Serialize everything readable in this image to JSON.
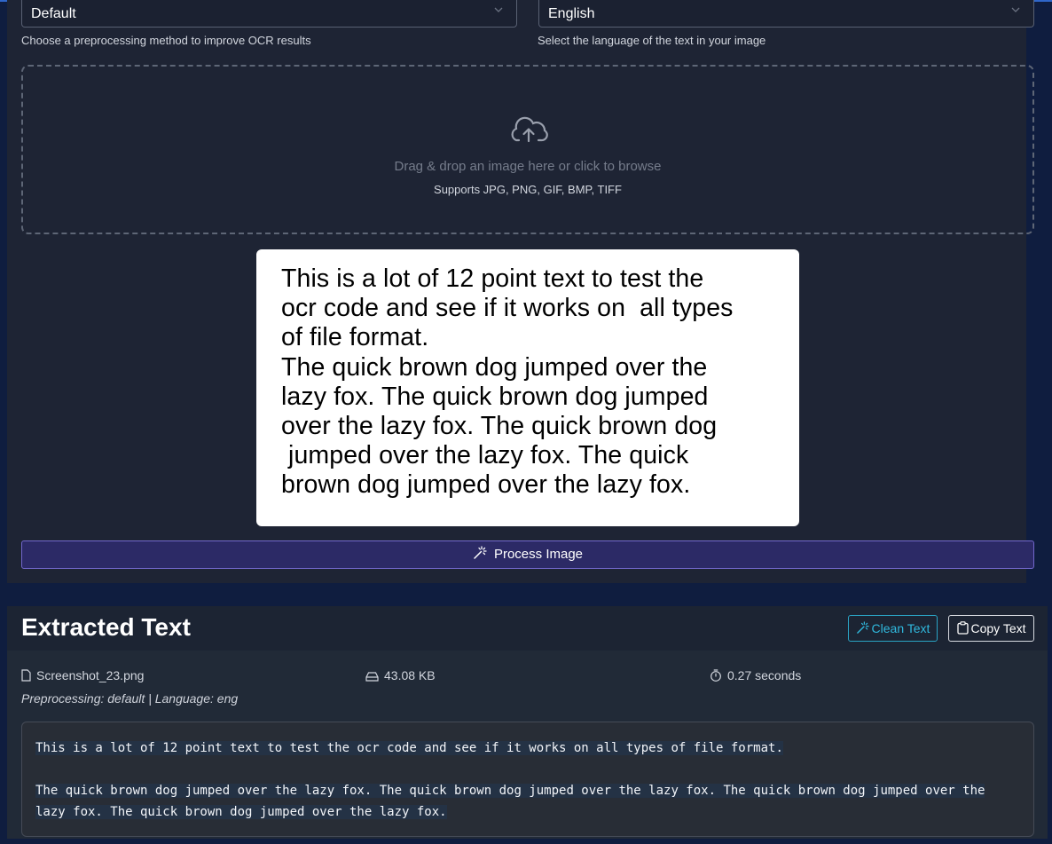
{
  "colors": {
    "background": "#0f1d3f",
    "panel": "#1e2434",
    "accent_purple": "#2c2a66",
    "accent_cyan": "#30b9de"
  },
  "preprocessing": {
    "selected": "Default",
    "hint": "Choose a preprocessing method to improve OCR results"
  },
  "language": {
    "selected": "English",
    "hint": "Select the language of the text in your image"
  },
  "dropzone": {
    "icon": "cloud-upload-icon",
    "main_text": "Drag & drop an image here or click to browse",
    "sub_text": "Supports JPG, PNG, GIF, BMP, TIFF"
  },
  "preview_image": {
    "lines": [
      "This is a lot of 12 point text to test the",
      "ocr code and see if it works on  all types",
      "of file format.",
      "The quick brown dog jumped over the",
      "lazy fox. The quick brown dog jumped",
      "over the lazy fox. The quick brown dog",
      " jumped over the lazy fox. The quick",
      "brown dog jumped over the lazy fox."
    ]
  },
  "process_button": {
    "label": "Process Image",
    "icon": "magic-wand-icon"
  },
  "result": {
    "title": "Extracted Text",
    "clean_label": "Clean Text",
    "copy_label": "Copy Text",
    "file_name": "Screenshot_23.png",
    "file_size": "43.08 KB",
    "duration": "0.27 seconds",
    "details": "Preprocessing: default | Language: eng",
    "paragraph_1": "This is a lot of 12 point text to test the ocr code and see if it works on all types of file format.",
    "paragraph_2": "The quick brown dog jumped over the lazy fox. The quick brown dog jumped over the lazy fox. The quick brown dog jumped over the lazy fox. The quick brown dog jumped over the lazy fox."
  }
}
